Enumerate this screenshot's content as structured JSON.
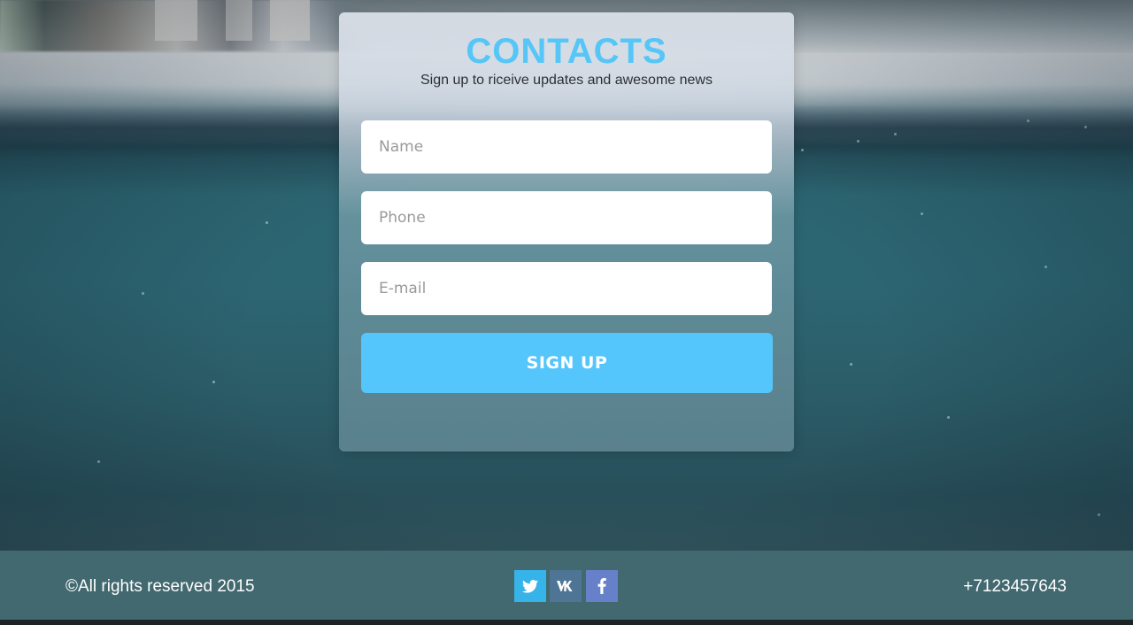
{
  "contact_form": {
    "title": "CONTACTS",
    "subtitle": "Sign up to riceive updates and awesome news",
    "fields": {
      "name_placeholder": "Name",
      "phone_placeholder": "Phone",
      "email_placeholder": "E-mail"
    },
    "submit_label": "SIGN UP"
  },
  "footer": {
    "copyright": "©All rights reserved 2015",
    "phone": "+7123457643",
    "social": [
      {
        "icon": "twitter-icon"
      },
      {
        "icon": "vk-icon"
      },
      {
        "icon": "facebook-icon"
      }
    ]
  },
  "colors": {
    "accent": "#55c6fb",
    "footer_background": "#426970",
    "twitter": "#36b3e9",
    "vk": "#4f7596",
    "facebook": "#6680c9"
  }
}
